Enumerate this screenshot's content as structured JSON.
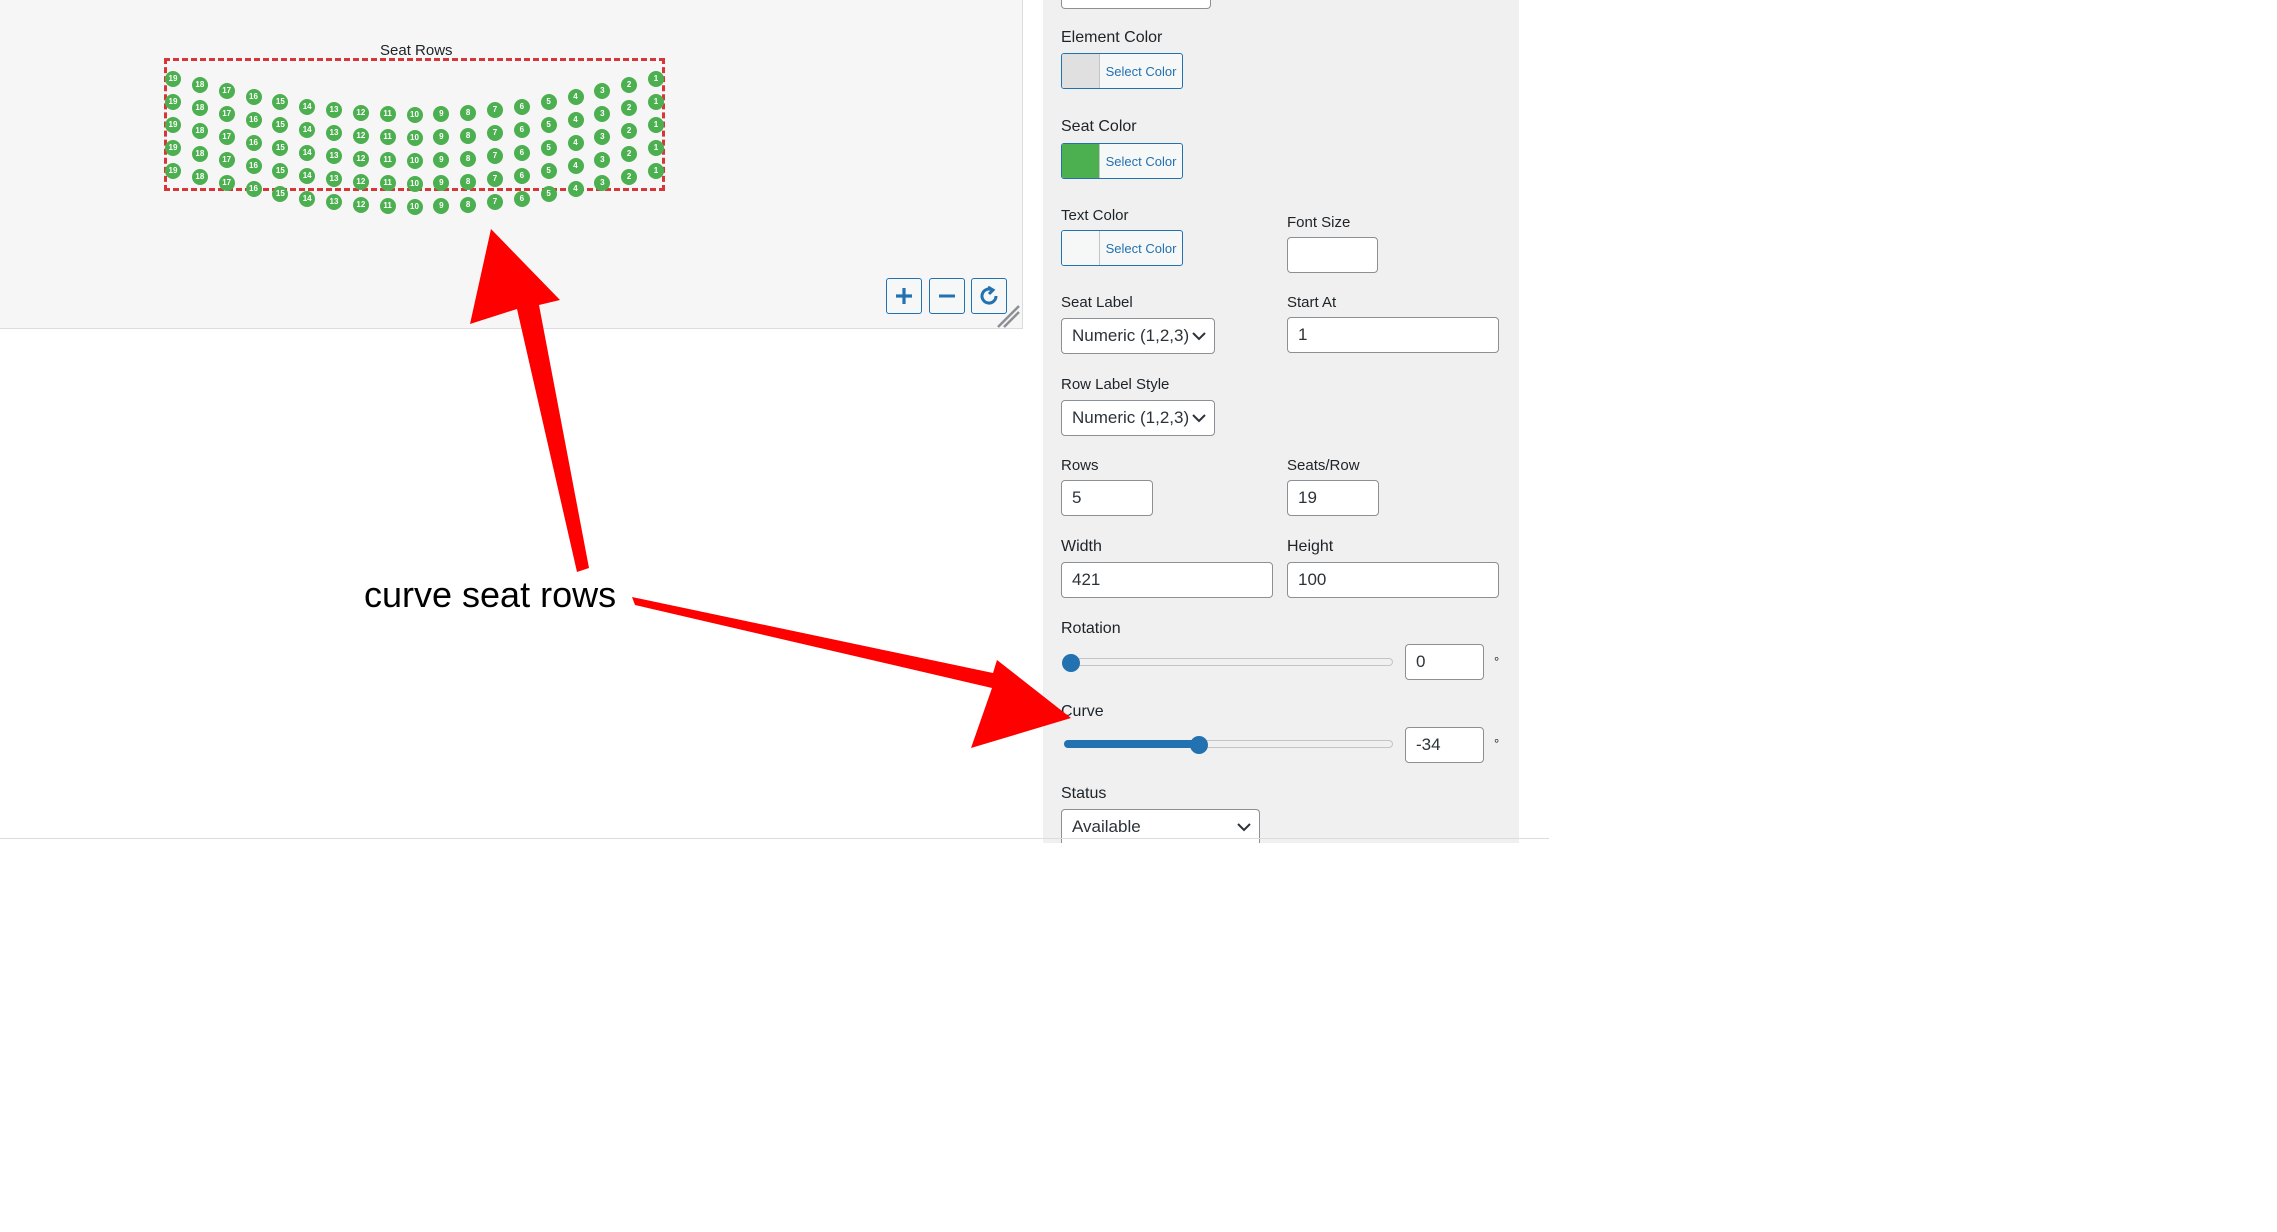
{
  "canvas": {
    "seat_block_title": "Seat Rows",
    "seat_color": "#4caf50",
    "selection_color": "#d63638",
    "rows": [
      [
        19,
        18,
        17,
        16,
        15,
        14,
        13,
        12,
        11,
        10,
        9,
        8,
        7,
        6,
        5,
        4,
        3,
        2,
        1
      ],
      [
        19,
        18,
        17,
        16,
        15,
        14,
        13,
        12,
        11,
        10,
        9,
        8,
        7,
        6,
        5,
        4,
        3,
        2,
        1
      ],
      [
        19,
        18,
        17,
        16,
        15,
        14,
        13,
        12,
        11,
        10,
        9,
        8,
        7,
        6,
        5,
        4,
        3,
        2,
        1
      ],
      [
        19,
        18,
        17,
        16,
        15,
        14,
        13,
        12,
        11,
        10,
        9,
        8,
        7,
        6,
        5,
        4,
        3,
        2,
        1
      ],
      [
        19,
        18,
        17,
        16,
        15,
        14,
        13,
        12,
        11,
        10,
        9,
        8,
        7,
        6,
        5,
        4,
        3,
        2,
        1
      ]
    ],
    "zoom_in_icon": "plus-icon",
    "zoom_out_icon": "minus-icon",
    "reset_icon": "reset-rotate-icon"
  },
  "panel": {
    "element_color_label": "Element Color",
    "element_color_button": "Select Color",
    "element_color_value": "#e0e0e0",
    "seat_color_label": "Seat Color",
    "seat_color_button": "Select Color",
    "seat_color_value": "#4caf50",
    "text_color_label": "Text Color",
    "text_color_button": "Select Color",
    "text_color_value": "#f6f7f7",
    "font_size_label": "Font Size",
    "font_size_value": "",
    "seat_label_label": "Seat Label",
    "seat_label_value": "Numeric (1,2,3)",
    "start_at_label": "Start At",
    "start_at_value": "1",
    "row_label_style_label": "Row Label Style",
    "row_label_style_value": "Numeric (1,2,3)",
    "rows_label": "Rows",
    "rows_value": "5",
    "seats_per_row_label": "Seats/Row",
    "seats_per_row_value": "19",
    "width_label": "Width",
    "width_value": "421",
    "height_label": "Height",
    "height_value": "100",
    "rotation_label": "Rotation",
    "rotation_value": "0",
    "rotation_fraction": 0.0,
    "degree_symbol": "°",
    "curve_label": "Curve",
    "curve_value": "-34",
    "curve_fraction": 0.41,
    "status_label": "Status",
    "status_value": "Available"
  },
  "annotation": {
    "text": "curve seat rows",
    "arrow_color": "#ff0000"
  }
}
